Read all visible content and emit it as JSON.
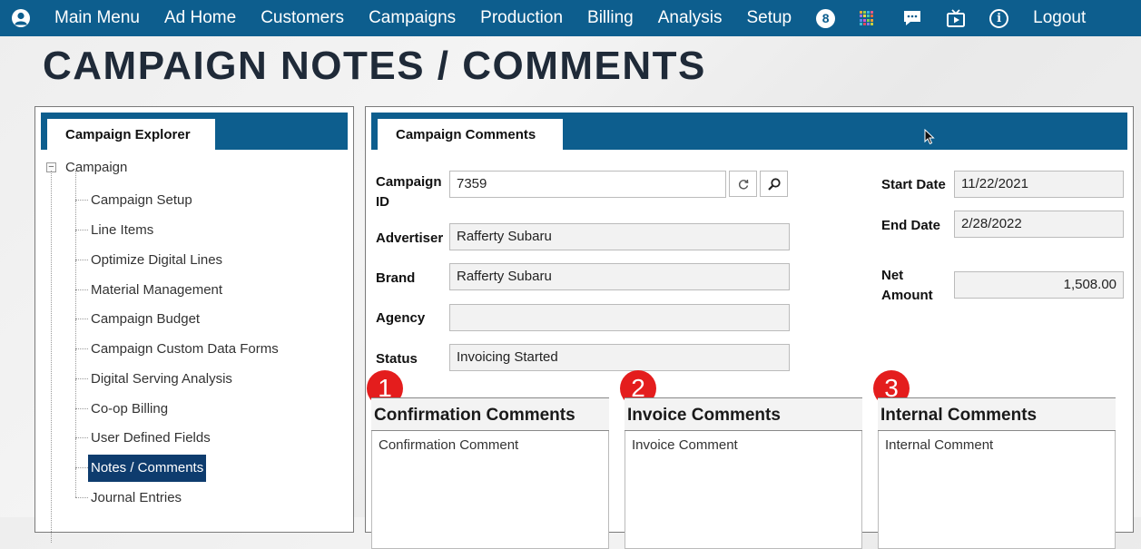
{
  "nav": {
    "items": [
      "Main Menu",
      "Ad Home",
      "Customers",
      "Campaigns",
      "Production",
      "Billing",
      "Analysis",
      "Setup"
    ],
    "badge": "8",
    "info_glyph": "i",
    "logout": "Logout",
    "icons": [
      "user-icon",
      "apps-grid-icon",
      "chat-icon",
      "video-icon",
      "info-icon"
    ]
  },
  "page": {
    "title": "CAMPAIGN NOTES / COMMENTS"
  },
  "explorer": {
    "tab": "Campaign Explorer",
    "root": "Campaign",
    "items": [
      "Campaign Setup",
      "Line Items",
      "Optimize Digital Lines",
      "Material Management",
      "Campaign Budget",
      "Campaign Custom Data Forms",
      "Digital Serving Analysis",
      "Co-op Billing",
      "User Defined Fields",
      "Notes / Comments",
      "Journal Entries"
    ],
    "active_item": "Notes / Comments"
  },
  "comments_panel": {
    "tab": "Campaign Comments",
    "campaign_id_label_1": "Campaign",
    "campaign_id_label_2": "ID",
    "campaign_id": "7359",
    "advertiser_label": "Advertiser",
    "advertiser": "Rafferty Subaru",
    "brand_label": "Brand",
    "brand": "Rafferty Subaru",
    "agency_label": "Agency",
    "agency": "",
    "status_label": "Status",
    "status": "Invoicing Started",
    "start_date_label": "Start Date",
    "start_date": "11/22/2021",
    "end_date_label": "End Date",
    "end_date": "2/28/2022",
    "net_amount_label_1": "Net",
    "net_amount_label_2": "Amount",
    "net_amount": "1,508.00",
    "sections": [
      {
        "number": "1",
        "title": "Confirmation Comments",
        "value": "Confirmation Comment"
      },
      {
        "number": "2",
        "title": "Invoice Comments",
        "value": "Invoice Comment"
      },
      {
        "number": "3",
        "title": "Internal Comments",
        "value": "Internal Comment"
      }
    ]
  },
  "colors": {
    "nav_bg": "#0d5e8e",
    "active_item_bg": "#0e3c6e",
    "callout": "#e41d1d"
  }
}
